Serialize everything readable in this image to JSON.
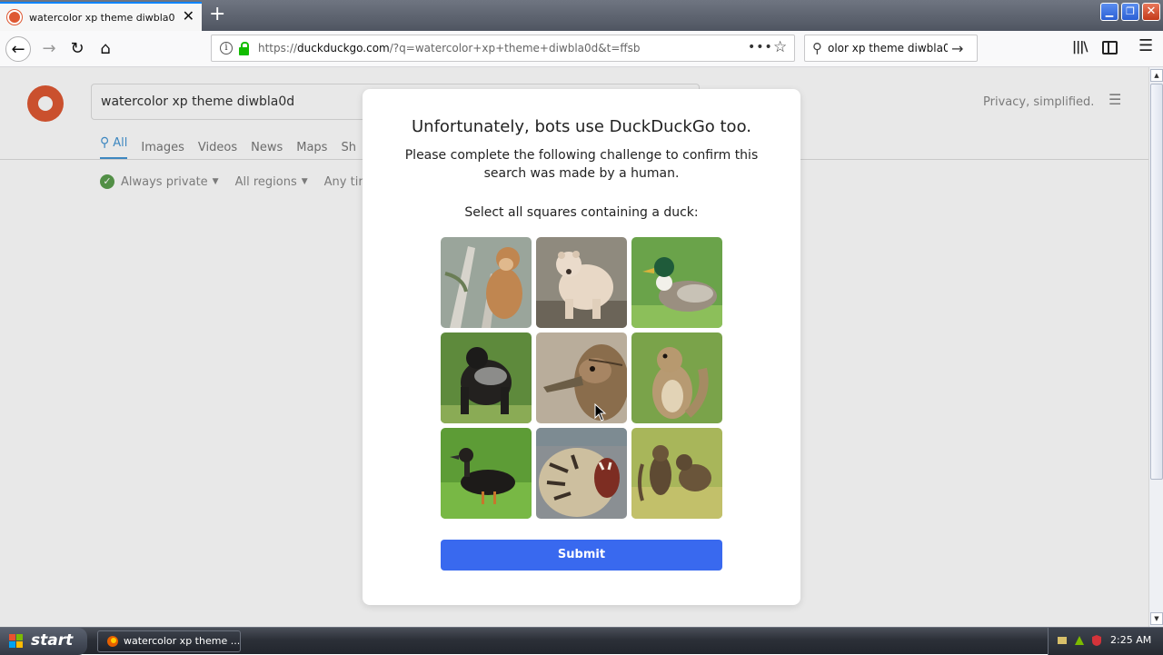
{
  "browser": {
    "tab_title": "watercolor xp theme diwbla0d at D",
    "url_prefix": "https://",
    "url_host": "duckduckgo.com",
    "url_path": "/?q=watercolor+xp+theme+diwbla0d&t=ffsb",
    "search_text": "olor xp theme diwbla0d",
    "icons": {
      "back": "arrow-left",
      "forward": "arrow-right",
      "reload": "reload",
      "home": "home",
      "bookmark": "star",
      "library": "library",
      "sidebar": "sidebar",
      "menu": "hamburger"
    }
  },
  "ddg": {
    "query": "watercolor xp theme diwbla0d",
    "tagline": "Privacy, simplified.",
    "tabs": [
      "All",
      "Images",
      "Videos",
      "News",
      "Maps",
      "Sh"
    ],
    "filters": [
      "Always private",
      "All regions",
      "Any tim"
    ]
  },
  "challenge": {
    "title": "Unfortunately, bots use DuckDuckGo too.",
    "description": "Please complete the following challenge to confirm this search was made by a human.",
    "prompt": "Select all squares containing a duck:",
    "submit_label": "Submit",
    "tiles": [
      "monkey",
      "bear",
      "duck",
      "gorilla",
      "duck",
      "squirrel",
      "duck",
      "tiger",
      "cats"
    ],
    "accent_color": "#3969ef"
  },
  "taskbar": {
    "start_label": "start",
    "task_label": "watercolor xp theme ...",
    "clock": "2:25 AM"
  }
}
